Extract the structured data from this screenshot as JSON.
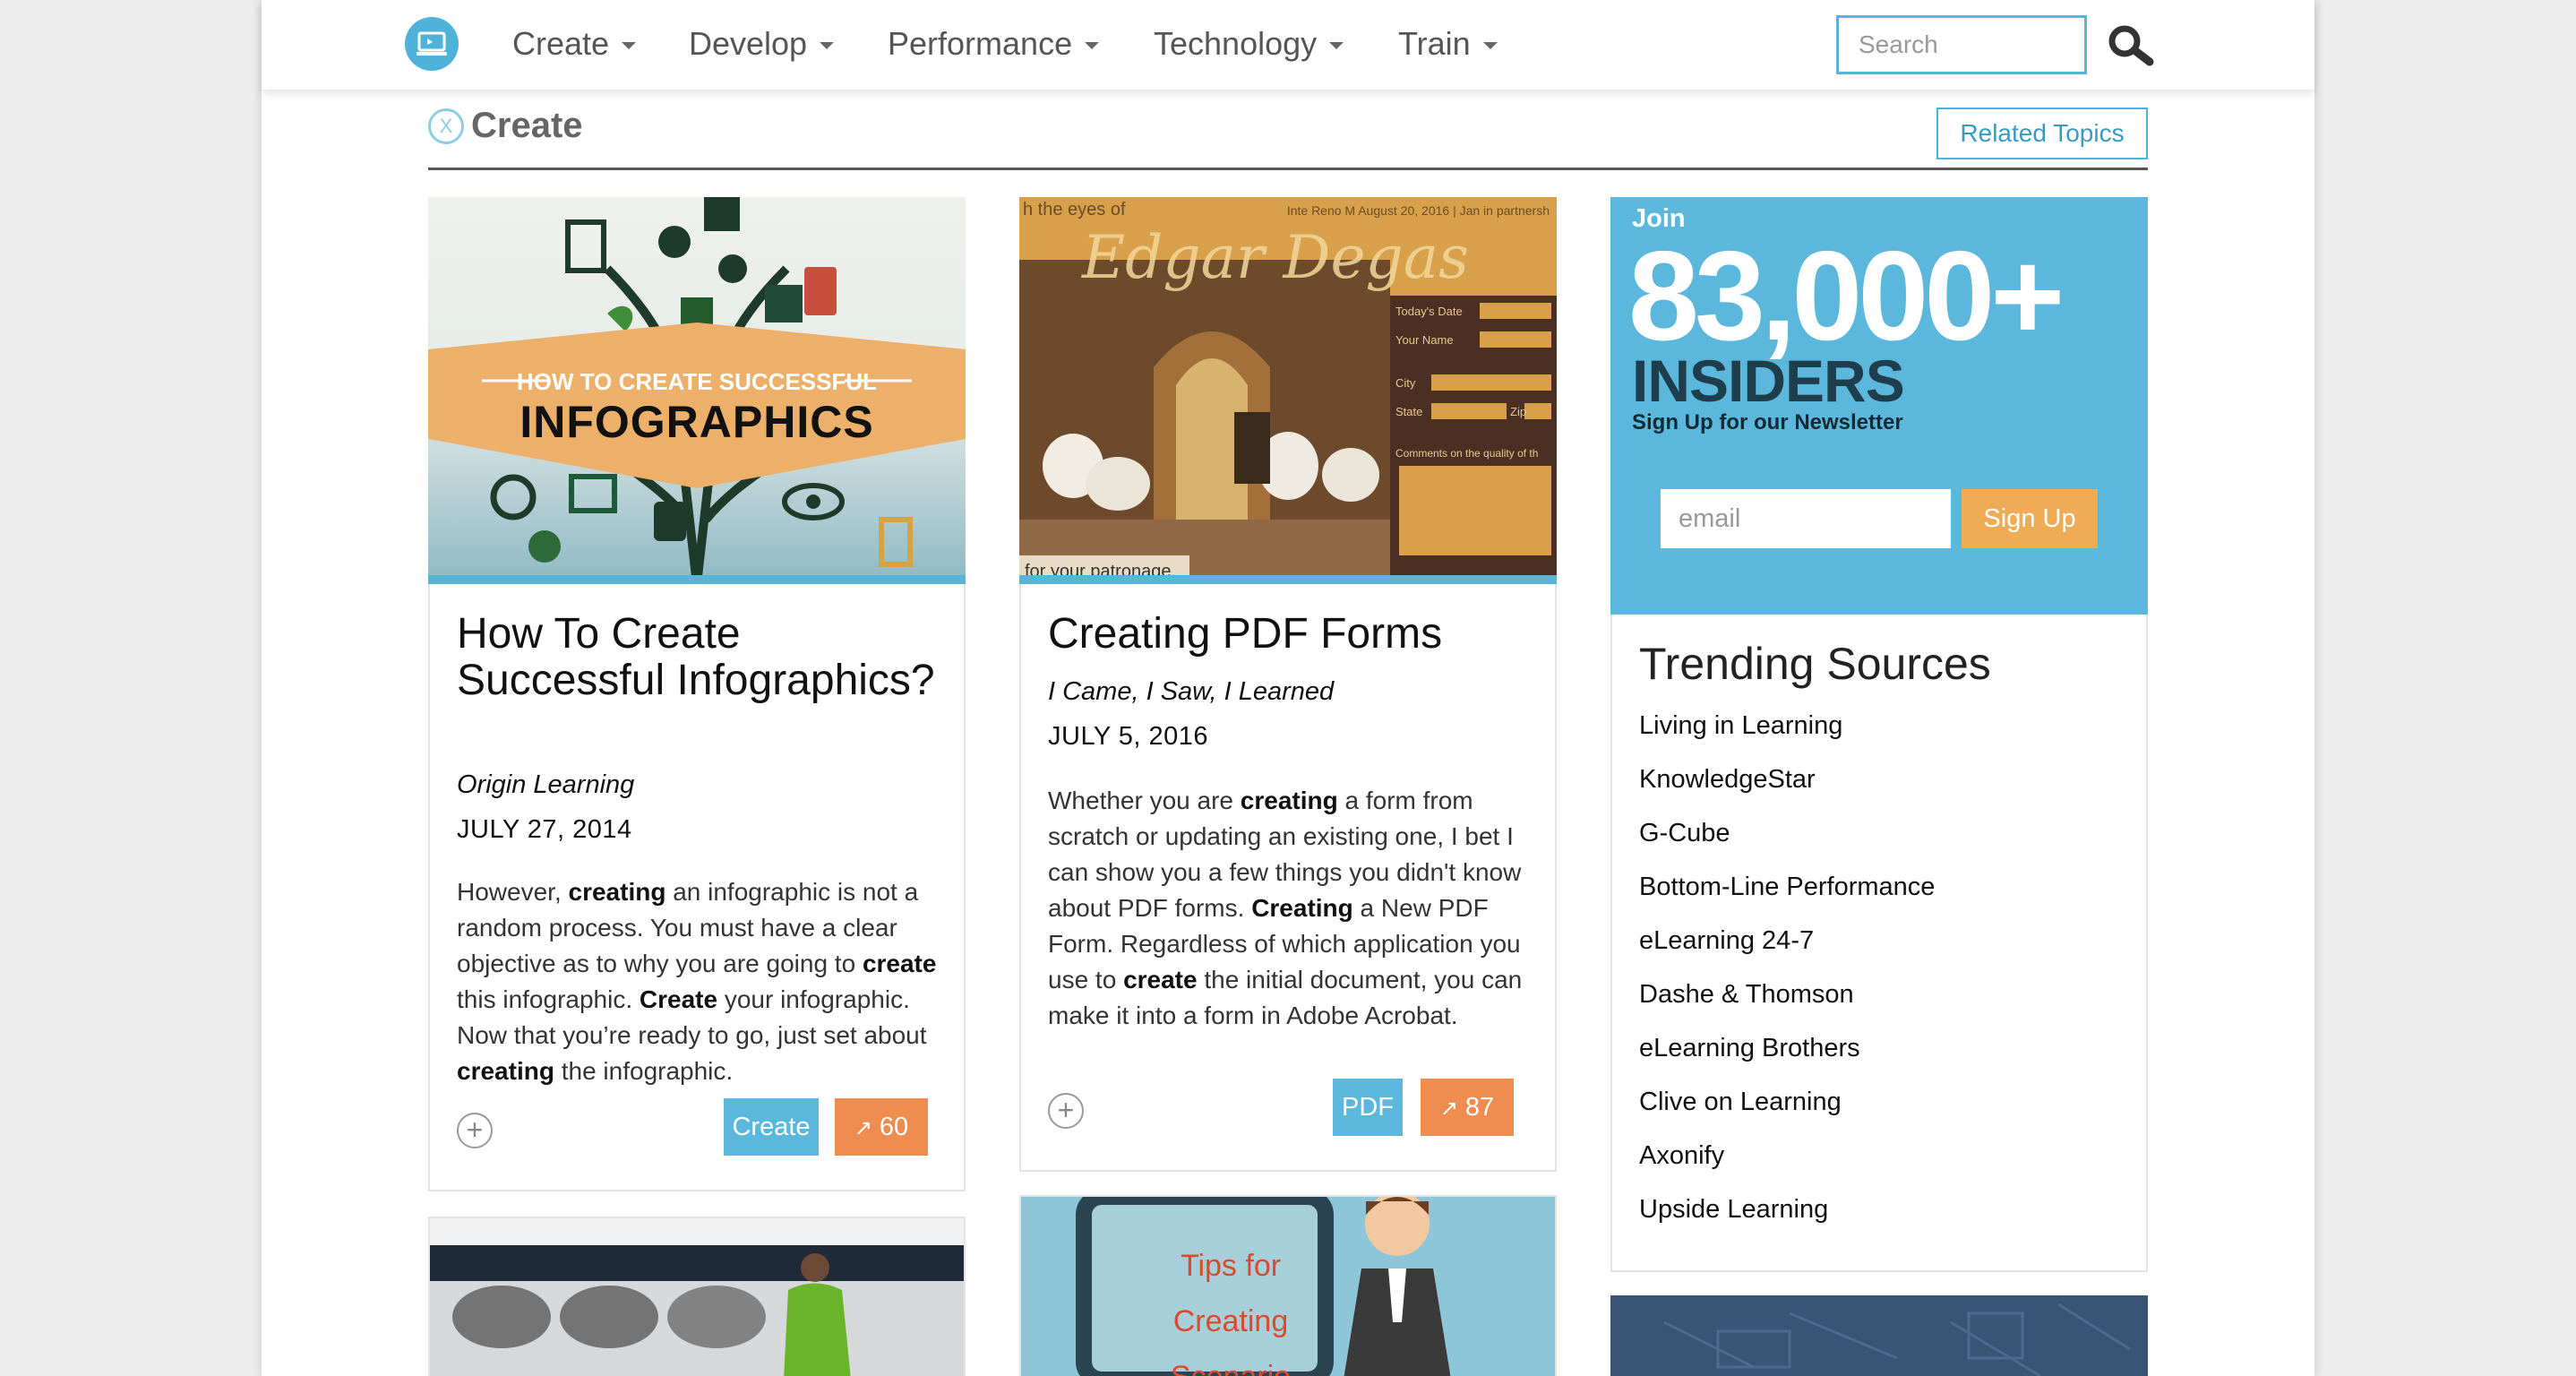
{
  "nav": {
    "items": [
      {
        "label": "Create"
      },
      {
        "label": "Develop"
      },
      {
        "label": "Performance"
      },
      {
        "label": "Technology"
      },
      {
        "label": "Train"
      }
    ],
    "search_placeholder": "Search"
  },
  "section": {
    "close_symbol": "X",
    "title": "Create",
    "related_label": "Related Topics"
  },
  "cards": [
    {
      "image_text": {
        "line1": "HOW TO CREATE SUCCESSFUL",
        "line2": "INFOGRAPHICS"
      },
      "title": "How To Create Successful Infographics?",
      "source": "Origin Learning",
      "date": "JULY 27, 2014",
      "excerpt": [
        {
          "t": "However, "
        },
        {
          "t": "creating",
          "b": true
        },
        {
          "t": " an infographic is not a random process. You must have a clear objective as to why you are going to "
        },
        {
          "t": "create",
          "b": true
        },
        {
          "t": " this infographic. "
        },
        {
          "t": "Create",
          "b": true
        },
        {
          "t": " your infographic. Now that you’re ready to go, just set about "
        },
        {
          "t": "creating",
          "b": true
        },
        {
          "t": " the infographic."
        }
      ],
      "tag": "Create",
      "trend_count": "60"
    },
    {
      "image_text": {
        "top_left": "h the eyes of",
        "script_title": "Edgar Degas",
        "top_right": "Inte Reno M August 20, 2016 | Jan in partnersh",
        "form_labels": [
          "Today's Date",
          "Your Name",
          "City",
          "State",
          "Zip",
          "Comments on the quality of th"
        ],
        "caption": "for your patronage."
      },
      "title": "Creating PDF Forms",
      "source": "I Came, I Saw, I Learned",
      "date": "JULY 5, 2016",
      "excerpt": [
        {
          "t": "Whether you are "
        },
        {
          "t": "creating",
          "b": true
        },
        {
          "t": " a form from scratch or updating an existing one, I bet I can show you a few things you didn't know about PDF forms. "
        },
        {
          "t": "Creating",
          "b": true
        },
        {
          "t": " a New PDF Form. Regardless of which application you use to "
        },
        {
          "t": "create",
          "b": true
        },
        {
          "t": " the initial document, you can make it into a form in Adobe Acrobat."
        }
      ],
      "tag": "PDF",
      "trend_count": "87"
    }
  ],
  "next_card_text": {
    "line1": "Tips for",
    "line2": "Creating",
    "line3": "Scenario"
  },
  "newsletter": {
    "join": "Join",
    "count": "83,000+",
    "insiders": "INSIDERS",
    "subtitle": "Sign Up for our Newsletter",
    "email_placeholder": "email",
    "signup_label": "Sign Up"
  },
  "trending": {
    "title": "Trending Sources",
    "items": [
      "Living in Learning",
      "KnowledgeStar",
      "G-Cube",
      "Bottom-Line Performance",
      "eLearning 24-7",
      "Dashe & Thomson",
      "eLearning Brothers",
      "Clive on Learning",
      "Axonify",
      "Upside Learning"
    ]
  },
  "colors": {
    "accent_blue": "#5bb8dc",
    "accent_orange": "#ee8d4f",
    "signup_orange": "#f0ac54"
  }
}
